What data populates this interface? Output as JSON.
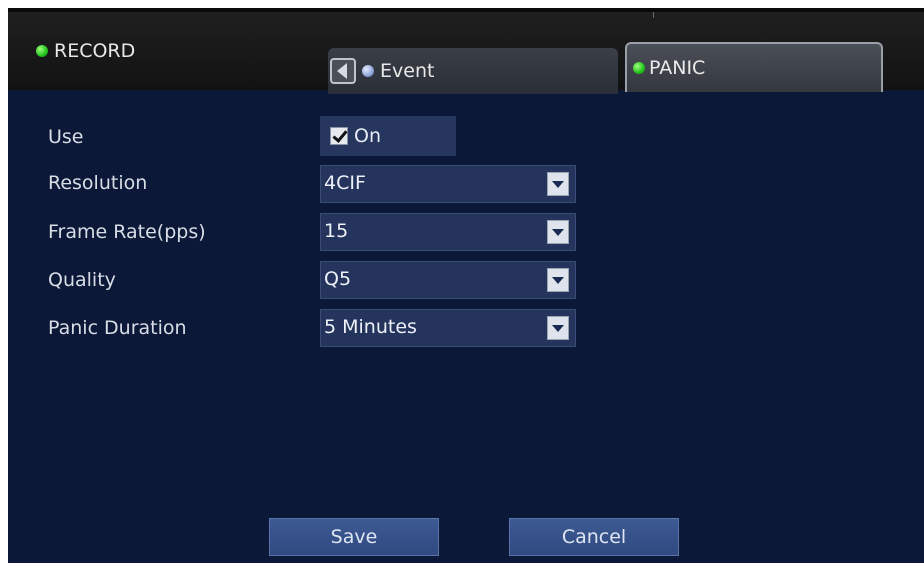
{
  "header": {
    "record_label": "RECORD",
    "tabs": [
      {
        "label": "Event",
        "status_color": "#8fa5d8"
      },
      {
        "label": "PANIC",
        "status_color": "#22c21c",
        "active": true
      }
    ]
  },
  "form": {
    "use": {
      "label": "Use",
      "checkbox_label": "On",
      "checked": true
    },
    "resolution": {
      "label": "Resolution",
      "value": "4CIF"
    },
    "frame_rate": {
      "label": "Frame Rate(pps)",
      "value": "15"
    },
    "quality": {
      "label": "Quality",
      "value": "Q5"
    },
    "panic_duration": {
      "label": "Panic Duration",
      "value": "5 Minutes"
    }
  },
  "buttons": {
    "save": "Save",
    "cancel": "Cancel"
  },
  "colors": {
    "background": "#0b1838",
    "field": "#24345d",
    "button": "#3e5a94",
    "record_indicator": "#22c21c"
  }
}
